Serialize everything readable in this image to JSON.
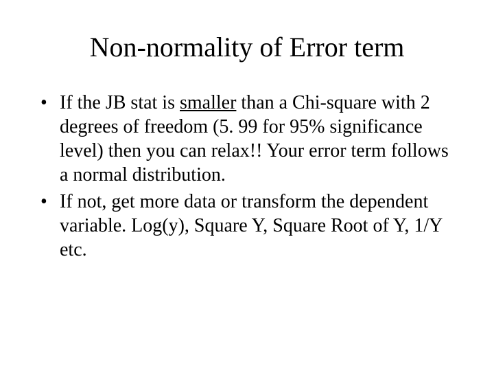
{
  "title": "Non-normality of Error term",
  "bullets": [
    {
      "pre": "If the JB stat is ",
      "underlined": "smaller",
      "post": " than a Chi-square with 2 degrees of freedom (5. 99 for 95% significance level) then you can relax!! Your error term follows a normal distribution."
    },
    {
      "pre": "If not, get more data or transform the dependent variable.  Log(y), Square Y, Square Root of Y, 1/Y etc.",
      "underlined": "",
      "post": ""
    }
  ]
}
